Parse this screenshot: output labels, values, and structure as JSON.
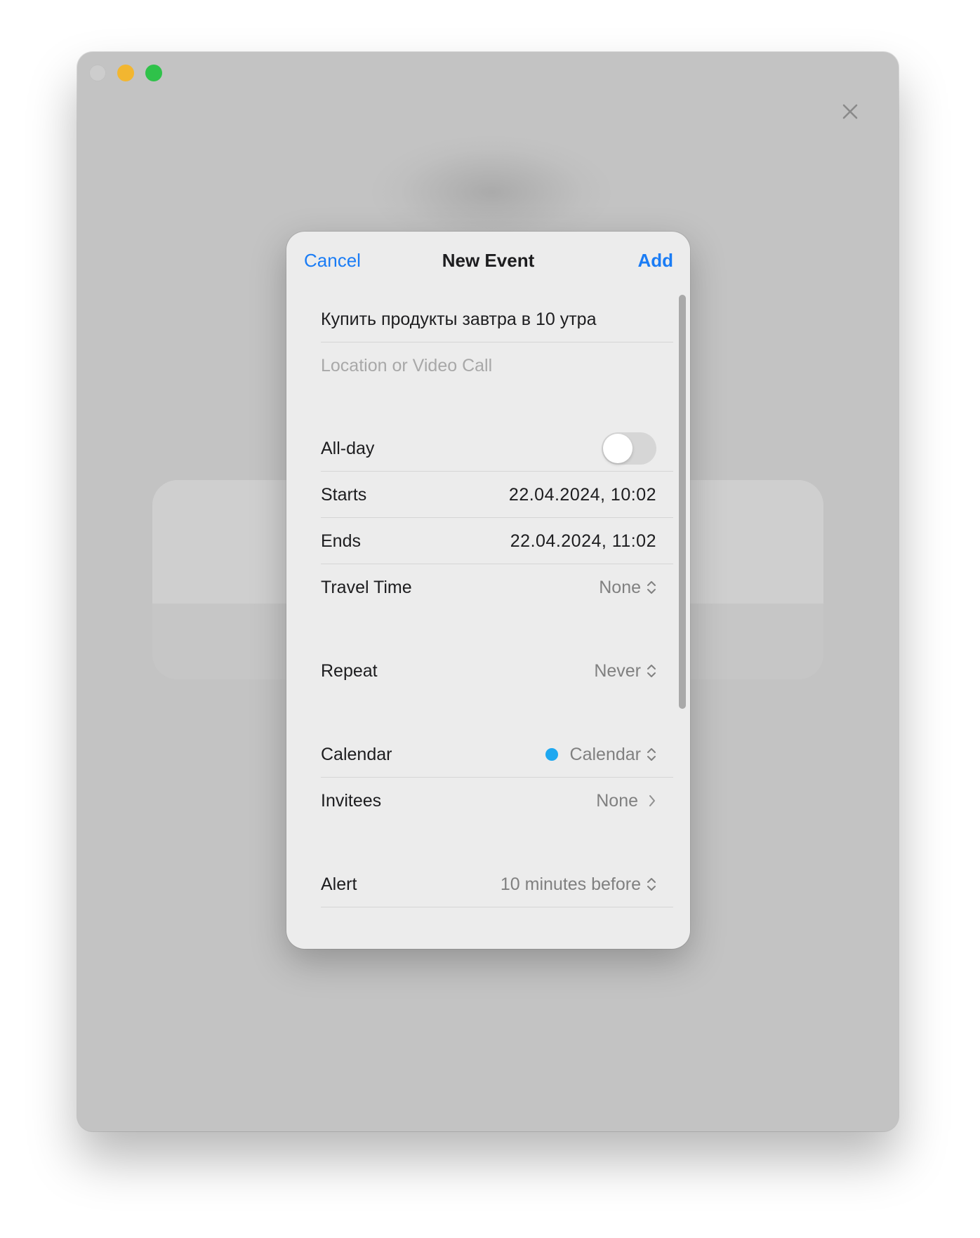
{
  "colors": {
    "accent": "#1a7cf5",
    "calendar_dot": "#1ea8f0",
    "traffic_min": "#f2b630",
    "traffic_max": "#2fc24a"
  },
  "window": {
    "close_icon": "close-icon"
  },
  "sheet": {
    "cancel_label": "Cancel",
    "title": "New Event",
    "add_label": "Add",
    "event_title_value": "Купить продукты завтра в 10 утра",
    "location_placeholder": "Location or Video Call",
    "allday": {
      "label": "All-day",
      "on": false
    },
    "starts": {
      "label": "Starts",
      "value": "22.04.2024,  10:02"
    },
    "ends": {
      "label": "Ends",
      "value": "22.04.2024,  11:02"
    },
    "travel_time": {
      "label": "Travel Time",
      "value": "None"
    },
    "repeat": {
      "label": "Repeat",
      "value": "Never"
    },
    "calendar": {
      "label": "Calendar",
      "value": "Calendar"
    },
    "invitees": {
      "label": "Invitees",
      "value": "None"
    },
    "alert": {
      "label": "Alert",
      "value": "10 minutes before"
    }
  }
}
